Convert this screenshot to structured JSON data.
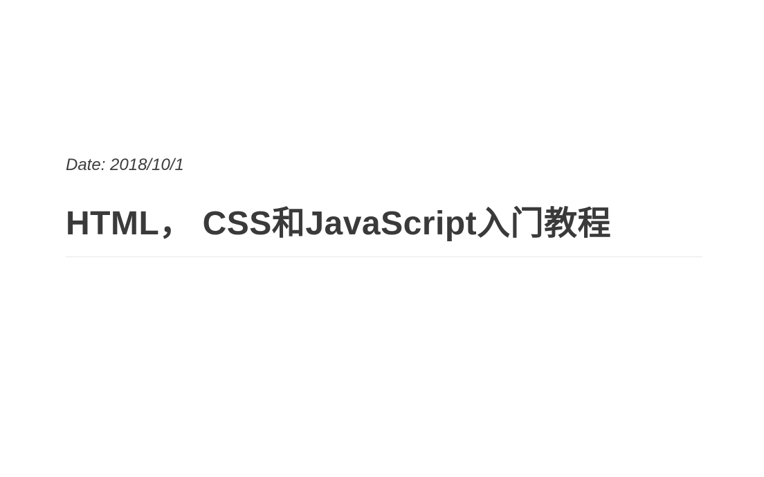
{
  "header": {
    "date_label": "Date: 2018/10/1",
    "title": "HTML， CSS和JavaScript入门教程"
  }
}
